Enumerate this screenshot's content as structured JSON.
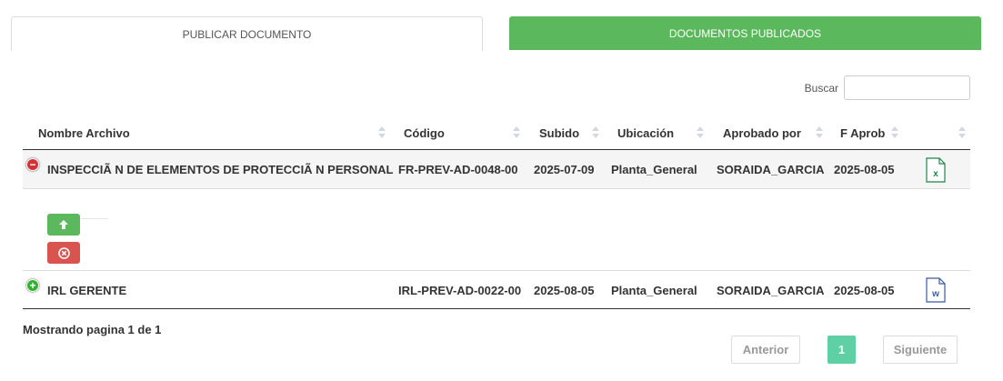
{
  "tabs": [
    {
      "label": "PUBLICAR DOCUMENTO",
      "active": true
    },
    {
      "label": "DOCUMENTOS PUBLICADOS",
      "active": false
    }
  ],
  "search": {
    "label": "Buscar",
    "value": "",
    "placeholder": ""
  },
  "table": {
    "headers": [
      "Nombre Archivo",
      "Código",
      "Subido",
      "Ubicación",
      "Aprobado por",
      "F Aprob",
      ""
    ],
    "rows": [
      {
        "expanded": true,
        "name": "INSPECCIÃ  N DE ELEMENTOS DE PROTECCIÃ  N PERSONAL",
        "code": "FR-PREV-AD-0048-00",
        "uploaded": "2025-07-09",
        "location": "Planta_General",
        "approved_by": "SORAIDA_GARCIA",
        "approved_date": "2025-08-05",
        "file_type": "excel",
        "file_letter": "x"
      },
      {
        "expanded": false,
        "name": "IRL GERENTE",
        "code": "IRL-PREV-AD-0022-00",
        "uploaded": "2025-08-05",
        "location": "Planta_General",
        "approved_by": "SORAIDA_GARCIA",
        "approved_date": "2025-08-05",
        "file_type": "word",
        "file_letter": "w"
      }
    ],
    "detail_actions": [
      {
        "icon": "arrow-up-icon",
        "color": "#5cb85c"
      },
      {
        "icon": "circle-x-icon",
        "color": "#d9534f"
      }
    ]
  },
  "footer": {
    "info": "Mostrando pagina 1 de 1"
  },
  "pagination": {
    "prev": "Anterior",
    "current": "1",
    "next": "Siguiente"
  },
  "colors": {
    "accent_green": "#5cb85c",
    "danger_red": "#d9534f",
    "page_active": "#5fcfa4",
    "excel_green": "#1e8449",
    "word_blue": "#3b5ba5"
  }
}
